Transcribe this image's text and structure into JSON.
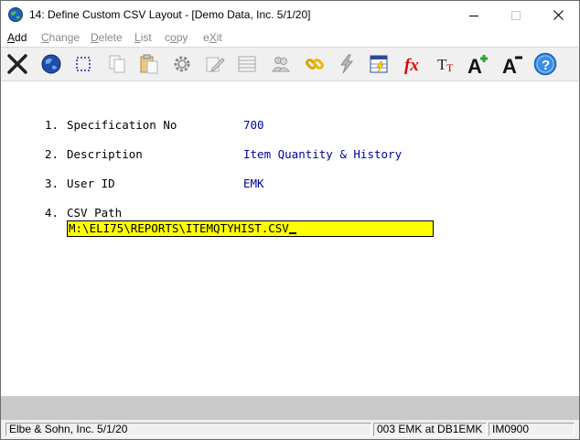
{
  "window": {
    "title": "14: Define Custom CSV Layout - [Demo Data, Inc. 5/1/20]"
  },
  "menu": [
    {
      "key": "A",
      "rest": "dd",
      "pre": "",
      "active": true
    },
    {
      "key": "C",
      "rest": "hange",
      "pre": "",
      "active": false
    },
    {
      "key": "D",
      "rest": "elete",
      "pre": "",
      "active": false
    },
    {
      "key": "L",
      "rest": "ist",
      "pre": "",
      "active": false
    },
    {
      "key": "o",
      "rest": "py",
      "pre": "c",
      "active": false
    },
    {
      "key": "X",
      "rest": "it",
      "pre": "e",
      "active": false
    }
  ],
  "toolbar": {
    "icons": [
      "exit-icon",
      "globe-icon",
      "select-icon",
      "copy-icon",
      "paste-icon",
      "settings-icon",
      "edit-icon",
      "list-icon",
      "users-icon",
      "link-icon",
      "lightning-icon",
      "spreadsheet-icon",
      "function-icon",
      "font-icon",
      "font-increase-icon",
      "font-decrease-icon",
      "help-icon"
    ]
  },
  "form": {
    "fields": [
      {
        "num": "1.",
        "label": "Specification No",
        "value": "700"
      },
      {
        "num": "2.",
        "label": "Description",
        "value": "Item Quantity & History"
      },
      {
        "num": "3.",
        "label": "User ID",
        "value": "EMK"
      },
      {
        "num": "4.",
        "label": "CSV Path",
        "value": ""
      }
    ],
    "csv_path": "M:\\ELI75\\REPORTS\\ITEMQTYHIST.CSV"
  },
  "status": {
    "company": "Elbe & Sohn, Inc. 5/1/20",
    "session": "003 EMK at DB1EMK",
    "program": "IM0900"
  },
  "colors": {
    "field_value": "#0000a0",
    "input_bg": "#ffff00"
  }
}
